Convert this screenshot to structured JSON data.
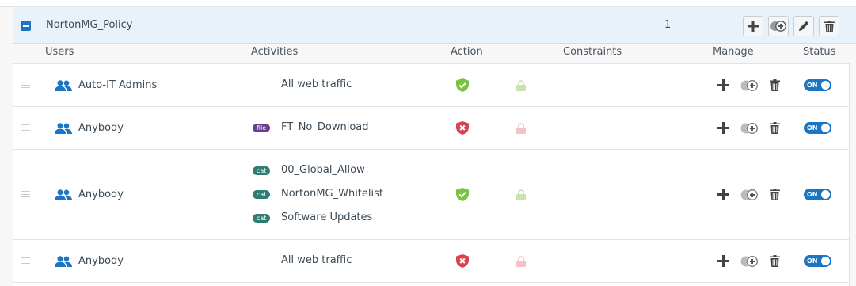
{
  "policy": {
    "name": "NortonMG_Policy",
    "count": "1",
    "buttons": [
      {
        "icon": "plus-icon"
      },
      {
        "icon": "clone-icon"
      },
      {
        "icon": "pencil-icon"
      },
      {
        "icon": "trash-icon"
      }
    ]
  },
  "columns": {
    "users": "Users",
    "activities": "Activities",
    "action": "Action",
    "constraints": "Constraints",
    "manage": "Manage",
    "status": "Status"
  },
  "rules": [
    {
      "user": "Auto-IT Admins",
      "activities": [
        {
          "tag": "",
          "text": "All web traffic"
        }
      ],
      "action": "allow",
      "status": "ON"
    },
    {
      "user": "Anybody",
      "activities": [
        {
          "tag": "file",
          "text": "FT_No_Download"
        }
      ],
      "action": "block",
      "status": "ON"
    },
    {
      "user": "Anybody",
      "activities": [
        {
          "tag": "cat",
          "text": "00_Global_Allow"
        },
        {
          "tag": "cat",
          "text": "NortonMG_Whitelist"
        },
        {
          "tag": "cat",
          "text": "Software Updates"
        }
      ],
      "action": "allow",
      "status": "ON"
    },
    {
      "user": "Anybody",
      "activities": [
        {
          "tag": "",
          "text": "All web traffic"
        }
      ],
      "action": "block",
      "status": "ON"
    }
  ],
  "colors": {
    "accent": "#1b75c4",
    "allow": "#7dc142",
    "block": "#d9434e",
    "lock_allow": "#c8e3b0",
    "lock_block": "#f3c1c8",
    "file_tag": "#6b3e8e",
    "cat_tag": "#2e7d73"
  }
}
